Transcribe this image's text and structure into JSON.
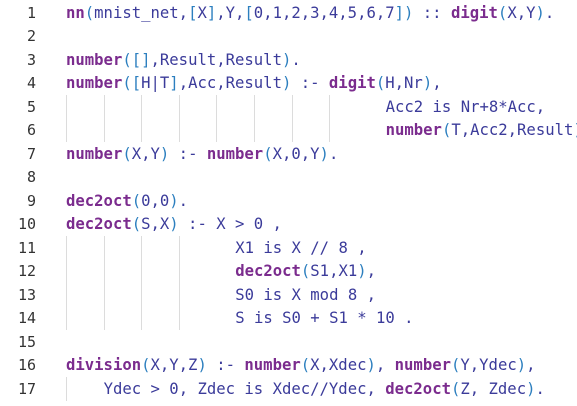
{
  "editor": {
    "lines": [
      {
        "n": "1",
        "indent": 0,
        "tokens": [
          [
            "fn",
            "nn"
          ],
          [
            "br",
            "("
          ],
          [
            "pl",
            "mnist_net,"
          ],
          [
            "br",
            "["
          ],
          [
            "pl",
            "X"
          ],
          [
            "br",
            "]"
          ],
          [
            "pl",
            ",Y,"
          ],
          [
            "br",
            "["
          ],
          [
            "pl",
            "0,1,2,3,4,5,6,7"
          ],
          [
            "br",
            "]"
          ],
          [
            "br",
            ")"
          ],
          [
            "pl",
            " :: "
          ],
          [
            "fn",
            "digit"
          ],
          [
            "br",
            "("
          ],
          [
            "pl",
            "X,Y"
          ],
          [
            "br",
            ")"
          ],
          [
            "pl",
            "."
          ]
        ]
      },
      {
        "n": "2",
        "indent": 0,
        "tokens": []
      },
      {
        "n": "3",
        "indent": 0,
        "tokens": [
          [
            "fn",
            "number"
          ],
          [
            "br",
            "("
          ],
          [
            "br",
            "[]"
          ],
          [
            "pl",
            ",Result,Result"
          ],
          [
            "br",
            ")"
          ],
          [
            "pl",
            "."
          ]
        ]
      },
      {
        "n": "4",
        "indent": 0,
        "tokens": [
          [
            "fn",
            "number"
          ],
          [
            "br",
            "("
          ],
          [
            "br",
            "["
          ],
          [
            "pl",
            "H|T"
          ],
          [
            "br",
            "]"
          ],
          [
            "pl",
            ",Acc,Result"
          ],
          [
            "br",
            ")"
          ],
          [
            "pl",
            " :- "
          ],
          [
            "fn",
            "digit"
          ],
          [
            "br",
            "("
          ],
          [
            "pl",
            "H,Nr"
          ],
          [
            "br",
            ")"
          ],
          [
            "pl",
            ","
          ]
        ]
      },
      {
        "n": "5",
        "indent": 34,
        "tokens": [
          [
            "pl",
            "Acc2 is Nr+8*Acc,"
          ]
        ]
      },
      {
        "n": "6",
        "indent": 34,
        "tokens": [
          [
            "fn",
            "number"
          ],
          [
            "br",
            "("
          ],
          [
            "pl",
            "T,Acc2,Result"
          ],
          [
            "br",
            ")"
          ],
          [
            "pl",
            "."
          ]
        ]
      },
      {
        "n": "7",
        "indent": 0,
        "tokens": [
          [
            "fn",
            "number"
          ],
          [
            "br",
            "("
          ],
          [
            "pl",
            "X,Y"
          ],
          [
            "br",
            ")"
          ],
          [
            "pl",
            " :- "
          ],
          [
            "fn",
            "number"
          ],
          [
            "br",
            "("
          ],
          [
            "pl",
            "X,0,Y"
          ],
          [
            "br",
            ")"
          ],
          [
            "pl",
            "."
          ]
        ]
      },
      {
        "n": "8",
        "indent": 0,
        "tokens": []
      },
      {
        "n": "9",
        "indent": 0,
        "tokens": [
          [
            "fn",
            "dec2oct"
          ],
          [
            "br",
            "("
          ],
          [
            "pl",
            "0,0"
          ],
          [
            "br",
            ")"
          ],
          [
            "pl",
            "."
          ]
        ]
      },
      {
        "n": "10",
        "indent": 0,
        "tokens": [
          [
            "fn",
            "dec2oct"
          ],
          [
            "br",
            "("
          ],
          [
            "pl",
            "S,X"
          ],
          [
            "br",
            ")"
          ],
          [
            "pl",
            " :- X > 0 ,"
          ]
        ]
      },
      {
        "n": "11",
        "indent": 18,
        "tokens": [
          [
            "pl",
            "X1 is X // 8 ,"
          ]
        ]
      },
      {
        "n": "12",
        "indent": 18,
        "tokens": [
          [
            "fn",
            "dec2oct"
          ],
          [
            "br",
            "("
          ],
          [
            "pl",
            "S1,X1"
          ],
          [
            "br",
            ")"
          ],
          [
            "pl",
            ","
          ]
        ]
      },
      {
        "n": "13",
        "indent": 18,
        "tokens": [
          [
            "pl",
            "S0 is X mod 8 ,"
          ]
        ]
      },
      {
        "n": "14",
        "indent": 18,
        "tokens": [
          [
            "pl",
            "S is S0 + S1 * 10 ."
          ]
        ]
      },
      {
        "n": "15",
        "indent": 0,
        "tokens": []
      },
      {
        "n": "16",
        "indent": 0,
        "tokens": [
          [
            "fn",
            "division"
          ],
          [
            "br",
            "("
          ],
          [
            "pl",
            "X,Y,Z"
          ],
          [
            "br",
            ")"
          ],
          [
            "pl",
            " :- "
          ],
          [
            "fn",
            "number"
          ],
          [
            "br",
            "("
          ],
          [
            "pl",
            "X,Xdec"
          ],
          [
            "br",
            ")"
          ],
          [
            "pl",
            ", "
          ],
          [
            "fn",
            "number"
          ],
          [
            "br",
            "("
          ],
          [
            "pl",
            "Y,Ydec"
          ],
          [
            "br",
            ")"
          ],
          [
            "pl",
            ","
          ]
        ]
      },
      {
        "n": "17",
        "indent": 4,
        "tokens": [
          [
            "pl",
            "Ydec > 0, Zdec is Xdec//Ydec, "
          ],
          [
            "fn",
            "dec2oct"
          ],
          [
            "br",
            "("
          ],
          [
            "pl",
            "Z, Zdec"
          ],
          [
            "br",
            ")"
          ],
          [
            "pl",
            "."
          ]
        ]
      }
    ]
  },
  "colors": {
    "predicate": "#7b2c8e",
    "bracket": "#2c7fbf",
    "text": "#3b3b9a",
    "line_number": "#333333",
    "indent_guide": "#dcdcdc"
  }
}
